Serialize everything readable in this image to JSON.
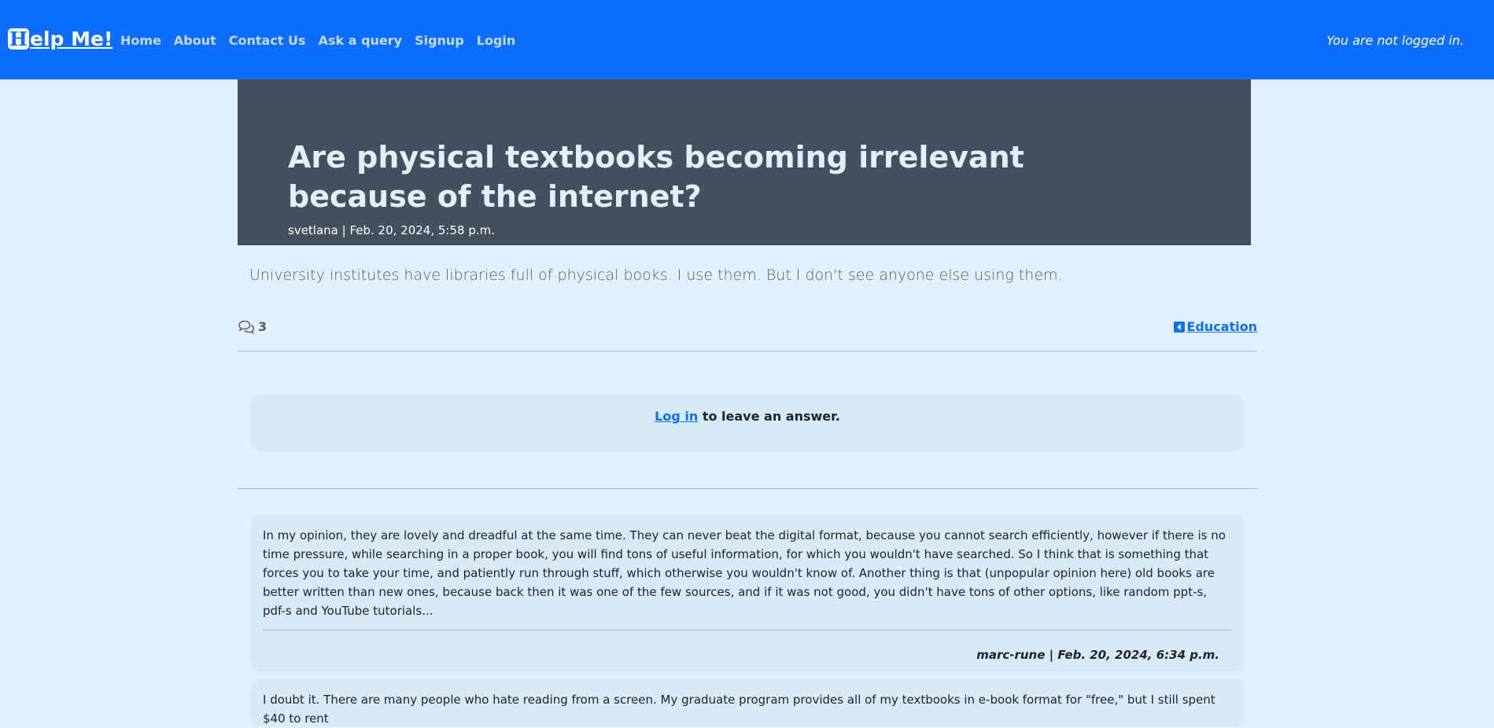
{
  "navbar": {
    "brand_logo_letter": "H",
    "brand_rest": "elp Me!",
    "links": [
      "Home",
      "About",
      "Contact Us",
      "Ask a query",
      "Signup",
      "Login"
    ],
    "status": "You are not logged in."
  },
  "question": {
    "title": "Are physical textbooks becoming irrelevant because of the internet?",
    "meta": "svetlana | Feb. 20, 2024, 5:58 p.m.",
    "body": "University institutes have libraries full of physical books. I use them. But I don't see anyone else using them.",
    "answer_count": "3",
    "category": "Education"
  },
  "login_prompt": {
    "link": "Log in",
    "rest": " to leave an answer."
  },
  "answers": [
    {
      "text": "In my opinion, they are lovely and dreadful at the same time. They can never beat the digital format, because you cannot search efficiently, however if there is no time pressure, while searching in a proper book, you will find tons of useful information, for which you wouldn't have searched. So I think that is something that forces you to take your time, and patiently run through stuff, which otherwise you wouldn't know of. Another thing is that (unpopular opinion here) old books are better written than new ones, because back then it was one of the few sources, and if it was not good, you didn't have tons of other options, like random ppt-s, pdf-s and YouTube tutorials...",
      "by": "marc-rune | Feb. 20, 2024, 6:34 p.m."
    },
    {
      "text": "I doubt it. There are many people who hate reading from a screen. My graduate program provides all of my textbooks in e-book format for \"free,\" but I still spent $40 to rent",
      "by": ""
    }
  ],
  "colors": {
    "navbar": "#0d6efd",
    "hero": "#45505f",
    "page_bg": "#e2f0fc",
    "card_bg": "#d8e9f7"
  }
}
